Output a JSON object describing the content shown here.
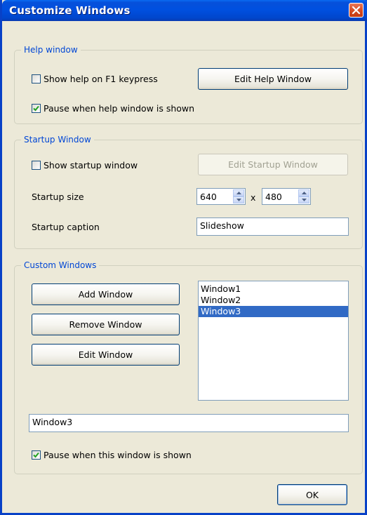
{
  "window": {
    "title": "Customize Windows"
  },
  "help_window": {
    "legend": "Help window",
    "show_help_f1": {
      "label": "Show help on F1 keypress",
      "checked": false
    },
    "edit_button": "Edit Help Window",
    "pause_when_shown": {
      "label": "Pause when help window is shown",
      "checked": true
    }
  },
  "startup_window": {
    "legend": "Startup Window",
    "show_startup": {
      "label": "Show startup window",
      "checked": false
    },
    "edit_button": "Edit Startup Window",
    "size_label": "Startup size",
    "width": "640",
    "times": "x",
    "height": "480",
    "caption_label": "Startup caption",
    "caption_value": "Slideshow"
  },
  "custom_windows": {
    "legend": "Custom Windows",
    "add_button": "Add Window",
    "remove_button": "Remove Window",
    "edit_button": "Edit Window",
    "list": [
      "Window1",
      "Window2",
      "Window3"
    ],
    "selected": "Window3",
    "name_value": "Window3",
    "pause_when_shown": {
      "label": "Pause when this window is shown",
      "checked": true
    }
  },
  "ok_button": "OK",
  "colors": {
    "title_bar": "#0054e3",
    "legend_text": "#0046d5",
    "selection": "#316ac5"
  }
}
